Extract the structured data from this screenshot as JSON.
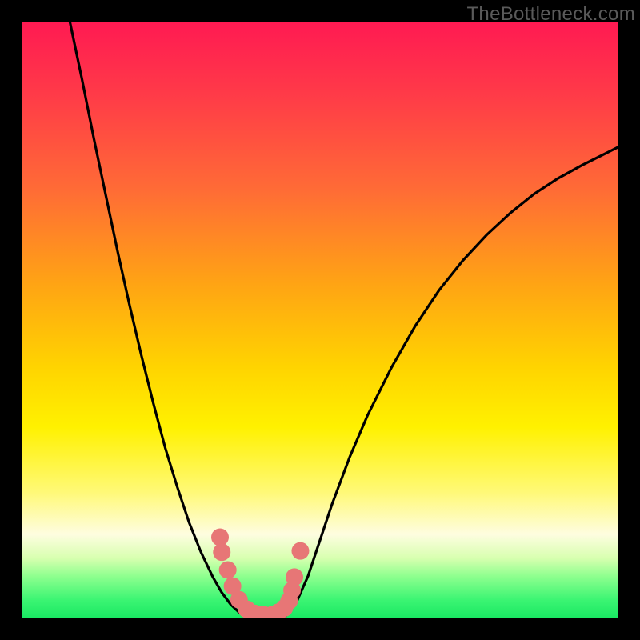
{
  "watermark": "TheBottleneck.com",
  "colors": {
    "background": "#000000",
    "curve": "#000000",
    "dot": "#e77676",
    "gradient_top": "#ff1a52",
    "gradient_bottom": "#1ae863"
  },
  "chart_data": {
    "type": "line",
    "title": "",
    "xlabel": "",
    "ylabel": "",
    "xlim": [
      0,
      100
    ],
    "ylim": [
      0,
      100
    ],
    "grid": false,
    "legend": false,
    "series": [
      {
        "name": "left-branch",
        "x": [
          8,
          10,
          12,
          14,
          16,
          18,
          20,
          22,
          24,
          26,
          28,
          30,
          32,
          33.5,
          35,
          36.5,
          38
        ],
        "values": [
          100,
          90.5,
          80.5,
          71,
          61.5,
          52.5,
          44,
          36,
          28.5,
          22,
          16,
          11,
          6.8,
          4.2,
          2.2,
          0.8,
          0
        ]
      },
      {
        "name": "right-branch",
        "x": [
          44,
          46,
          48,
          50,
          52,
          55,
          58,
          62,
          66,
          70,
          74,
          78,
          82,
          86,
          90,
          94,
          98,
          100
        ],
        "values": [
          0,
          2.5,
          7,
          13,
          19,
          27,
          34,
          42,
          49,
          55,
          60,
          64.3,
          68,
          71.2,
          73.8,
          76,
          78,
          79
        ]
      },
      {
        "name": "floor",
        "x": [
          38,
          40,
          42,
          44
        ],
        "values": [
          0,
          0,
          0,
          0
        ]
      }
    ],
    "dots": {
      "name": "highlight-dots",
      "x": [
        33.2,
        33.5,
        34.5,
        35.3,
        36.4,
        37.7,
        39.0,
        40.5,
        42.0,
        43.0,
        44.0,
        44.8,
        45.3,
        45.7,
        46.7
      ],
      "values": [
        13.5,
        11.0,
        8.0,
        5.3,
        3.0,
        1.4,
        0.7,
        0.5,
        0.5,
        0.9,
        1.6,
        2.8,
        4.6,
        6.8,
        11.2
      ]
    }
  }
}
